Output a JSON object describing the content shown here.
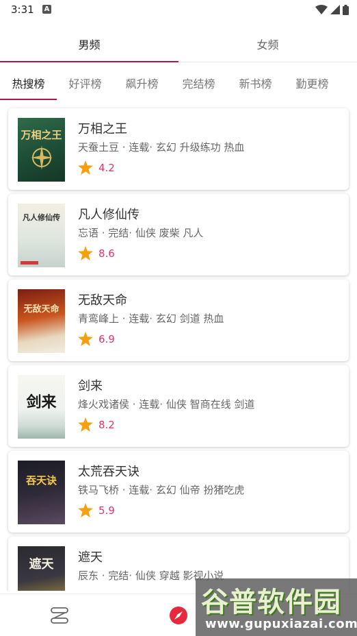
{
  "status_bar": {
    "time": "3:31",
    "indicator": "A"
  },
  "gender_tabs": [
    {
      "label": "男频",
      "active": true
    },
    {
      "label": "女频",
      "active": false
    }
  ],
  "rank_tabs": [
    {
      "label": "热搜榜",
      "active": true
    },
    {
      "label": "好评榜",
      "active": false
    },
    {
      "label": "飙升榜",
      "active": false
    },
    {
      "label": "完结榜",
      "active": false
    },
    {
      "label": "新书榜",
      "active": false
    },
    {
      "label": "勤更榜",
      "active": false
    }
  ],
  "books": [
    {
      "title": "万相之王",
      "meta": "天蚕土豆 · 连载· 玄幻 升级练功 热血",
      "rating": "4.2",
      "cover_text": "万相之王"
    },
    {
      "title": "凡人修仙传",
      "meta": "忘语 · 完结· 仙侠 废柴 凡人",
      "rating": "8.6",
      "cover_text": "凡人修仙传"
    },
    {
      "title": "无敌天命",
      "meta": "青鸾峰上 · 连载· 玄幻 剑道 热血",
      "rating": "6.9",
      "cover_text": "无敌天命"
    },
    {
      "title": "剑来",
      "meta": "烽火戏诸侯 · 连载· 仙侠 智商在线 剑道",
      "rating": "8.2",
      "cover_text": "剑来"
    },
    {
      "title": "太荒吞天诀",
      "meta": "铁马飞桥 · 连载· 玄幻 仙帝 扮猪吃虎",
      "rating": "5.9",
      "cover_text": "吞天诀"
    },
    {
      "title": "遮天",
      "meta": "辰东 · 完结· 仙侠 穿越 影视小说",
      "rating": "",
      "cover_text": "遮天"
    }
  ],
  "bottom_nav": {
    "items": [
      {
        "icon": "bookshelf-icon"
      },
      {
        "icon": "compass-icon"
      }
    ]
  },
  "watermark": {
    "logo": "谷普软件园",
    "url": "www.gupuxiazai.com"
  },
  "colors": {
    "accent": "#b0154f",
    "rating": "#e8306e",
    "star": "#f5a010"
  }
}
